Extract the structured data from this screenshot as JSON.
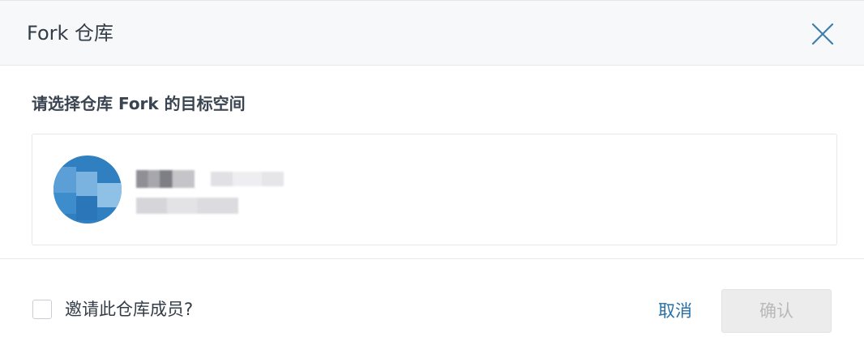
{
  "dialog": {
    "title": "Fork 仓库",
    "close_icon": "close-icon"
  },
  "body": {
    "prompt": "请选择仓库 Fork 的目标空间",
    "namespace": {
      "avatar_color": "#2f7fc1"
    }
  },
  "footer": {
    "invite_checked": false,
    "invite_label": "邀请此仓库成员?",
    "cancel_label": "取消",
    "confirm_label": "确认",
    "confirm_disabled": true
  },
  "colors": {
    "link": "#2670a8",
    "title_text": "#333d47",
    "disabled_bg": "#ececec",
    "disabled_text": "#b9b9b9"
  }
}
